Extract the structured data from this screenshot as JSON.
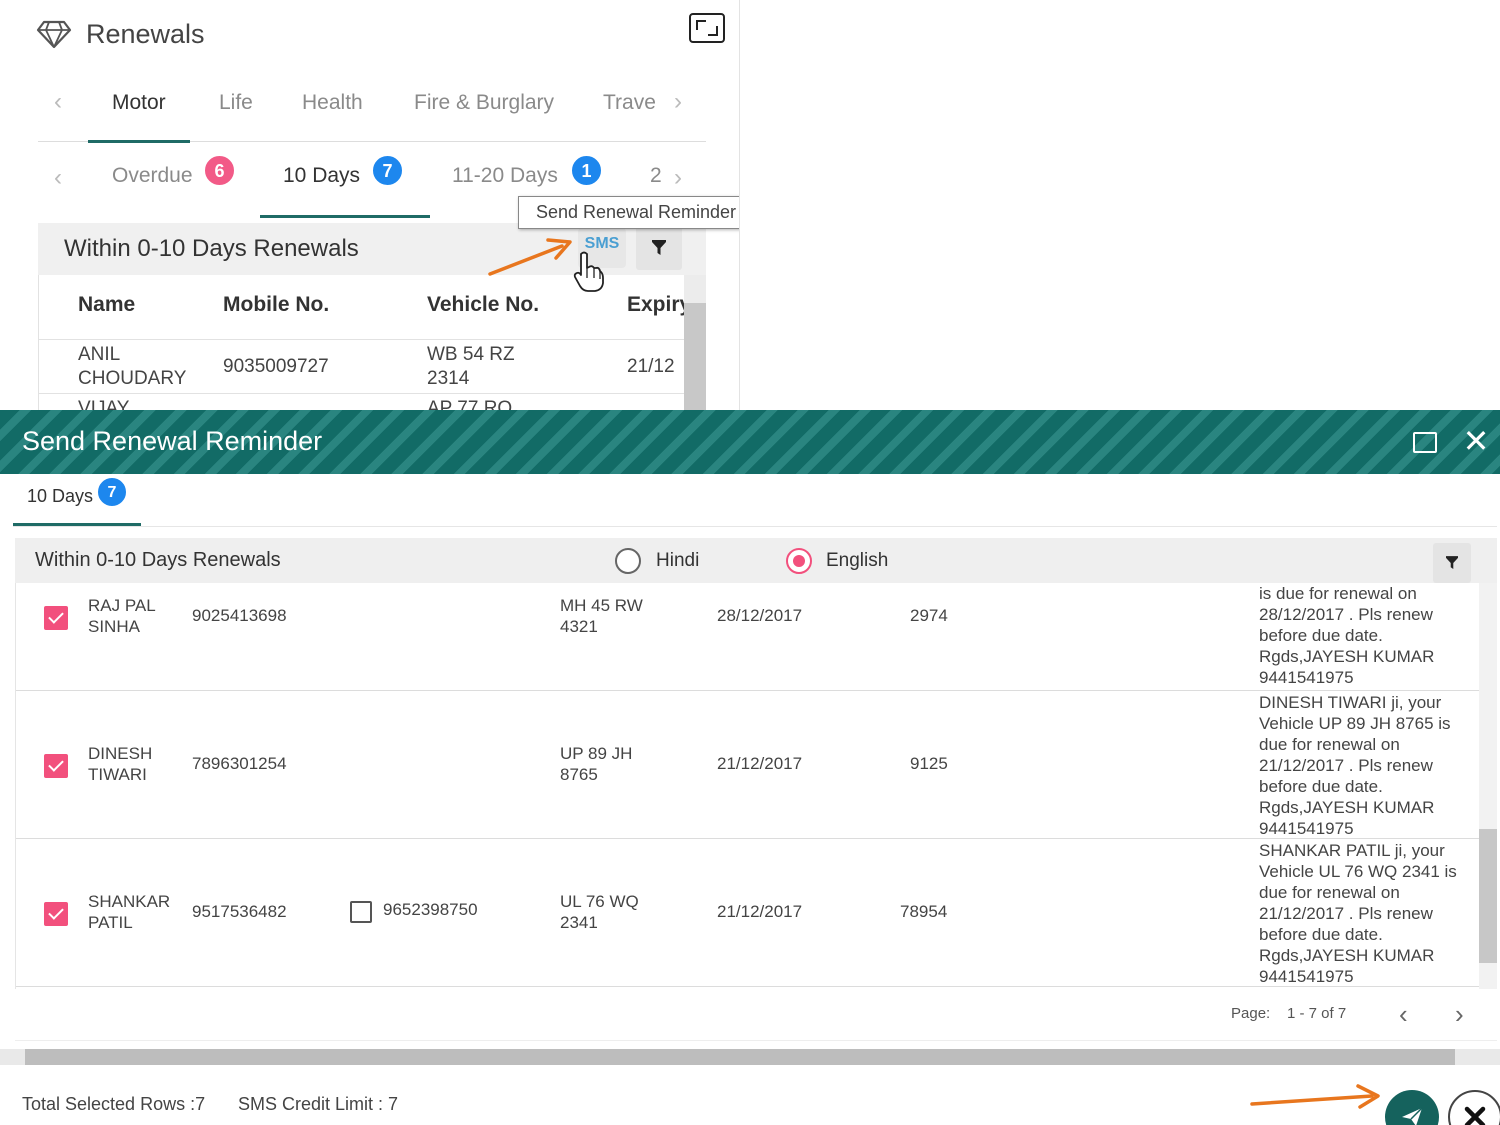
{
  "widget": {
    "title": "Renewals",
    "category_tabs": [
      "Motor",
      "Life",
      "Health",
      "Fire & Burglary",
      "Trave"
    ],
    "period_tabs": [
      {
        "label": "Overdue",
        "count": "6"
      },
      {
        "label": "10 Days",
        "count": "7"
      },
      {
        "label": "11-20 Days",
        "count": "1"
      },
      {
        "label": "2",
        "count": ""
      }
    ],
    "section_title": "Within 0-10 Days Renewals",
    "sms_label": "SMS",
    "tooltip": "Send Renewal Reminder",
    "table": {
      "headers": [
        "Name",
        "Mobile No.",
        "Vehicle No.",
        "Expiry"
      ],
      "rows": [
        {
          "name": "ANIL CHOUDARY",
          "mobile": "9035009727",
          "vehicle": "WB 54 RZ 2314",
          "expiry": "21/12"
        },
        {
          "name": "VIJAY",
          "mobile": "",
          "vehicle": "AP 77 RQ",
          "expiry": ""
        }
      ]
    }
  },
  "modal": {
    "title": "Send Renewal Reminder",
    "tab": {
      "label": "10 Days",
      "count": "7"
    },
    "section_title": "Within 0-10 Days Renewals",
    "languages": [
      {
        "label": "Hindi",
        "selected": false
      },
      {
        "label": "English",
        "selected": true
      }
    ],
    "rows": [
      {
        "name": "RAJ PAL SINHA",
        "mobile": "9025413698",
        "alt_mobile": "",
        "vehicle": "MH 45 RW 4321",
        "expiry": "28/12/2017",
        "premium": "2974",
        "message": "is due for renewal on 28/12/2017 . Pls renew before due date. Rgds,JAYESH KUMAR 9441541975"
      },
      {
        "name": "DINESH TIWARI",
        "mobile": "7896301254",
        "alt_mobile": "",
        "vehicle": "UP 89 JH 8765",
        "expiry": "21/12/2017",
        "premium": "9125",
        "message": "DINESH TIWARI ji, your Vehicle UP 89 JH 8765 is due for renewal on 21/12/2017 . Pls renew before due date. Rgds,JAYESH KUMAR 9441541975"
      },
      {
        "name": "SHANKAR PATIL",
        "mobile": "9517536482",
        "alt_mobile": "9652398750",
        "vehicle": "UL 76 WQ 2341",
        "expiry": "21/12/2017",
        "premium": "78954",
        "message": "SHANKAR PATIL ji, your Vehicle UL 76 WQ 2341 is due for renewal on 21/12/2017 . Pls renew before due date. Rgds,JAYESH KUMAR 9441541975"
      }
    ],
    "pager": {
      "label": "Page:",
      "range": "1 - 7 of 7"
    },
    "footer": {
      "total_selected": "Total Selected Rows :7",
      "sms_credit": "SMS Credit Limit : 7"
    }
  },
  "colors": {
    "teal": "#126b66",
    "pink": "#f2507d",
    "blue_badge": "#1d87ee",
    "arrow": "#e8761e"
  },
  "icons": [
    "diamond-icon",
    "fullscreen-icon",
    "chevron-left-icon",
    "chevron-right-icon",
    "filter-icon",
    "pointer-hand-icon",
    "maximize-icon",
    "close-icon",
    "send-icon",
    "cancel-icon"
  ]
}
